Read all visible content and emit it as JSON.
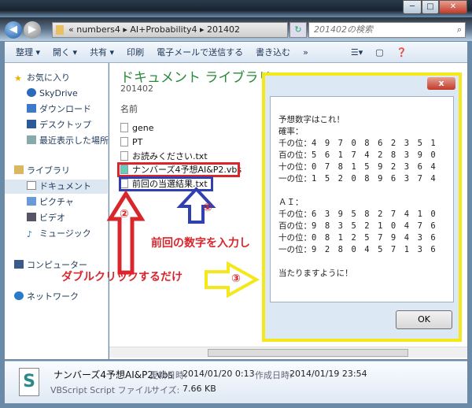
{
  "window": {
    "minimize": "─",
    "maximize": "□",
    "close": "✕"
  },
  "address": {
    "path": "« numbers4 ▸ AI+Probability4 ▸ 201402",
    "search_placeholder": "201402の検索"
  },
  "toolbar": {
    "items": [
      "整理 ▾",
      "開く ▾",
      "共有 ▾",
      "印刷",
      "電子メールで送信する",
      "書き込む",
      "»"
    ]
  },
  "sidebar": {
    "items": [
      "お気に入り",
      "SkyDrive",
      "ダウンロード",
      "デスクトップ",
      "最近表示した場所",
      "ライブラリ",
      "ドキュメント",
      "ピクチャ",
      "ビデオ",
      "ミュージック",
      "コンピューター",
      "ネットワーク"
    ]
  },
  "main": {
    "title": "ドキュメント ライブラリ",
    "subtitle": "201402",
    "column": "名前",
    "files": [
      "gene",
      "PT",
      "お読みください.txt",
      "ナンバーズ4予想AI&P2.vbs",
      "前回の当選結果.txt"
    ]
  },
  "dialog": {
    "close": "x",
    "text": "予想数字はこれ！\n確率：\n千の位：4　9　7　0　8　6　2　3　5　1\n百の位：5　6　1　7　4　2　8　3　9　0\n十の位：0　7　8　1　5　9　2　3　6　4\n一の位：1　5　2　0　8　9　6　3　7　4\n\nＡＩ：\n千の位：6　3　9　5　8　2　7　4　1　0\n百の位：9　8　3　5　2　1　0　4　7　6\n十の位：0　8　1　2　5　7　9　4　3　6\n一の位：9　2　8　0　4　5　7　1　3　6\n\n当たりますように！",
    "ok": "OK"
  },
  "annotations": {
    "step1": "①",
    "step2": "②",
    "step3": "③",
    "input_text": "前回の数字を入力し",
    "click_text": "ダブルクリックするだけ"
  },
  "details": {
    "filename": "ナンバーズ4予想AI&P2.vbs",
    "type": "VBScript Script ファイル",
    "modified_label": "更新日時:",
    "modified": "2014/01/20 0:13",
    "created_label": "作成日時:",
    "created": "2014/01/19 23:54",
    "size_label": "サイズ:",
    "size": "7.66 KB"
  }
}
